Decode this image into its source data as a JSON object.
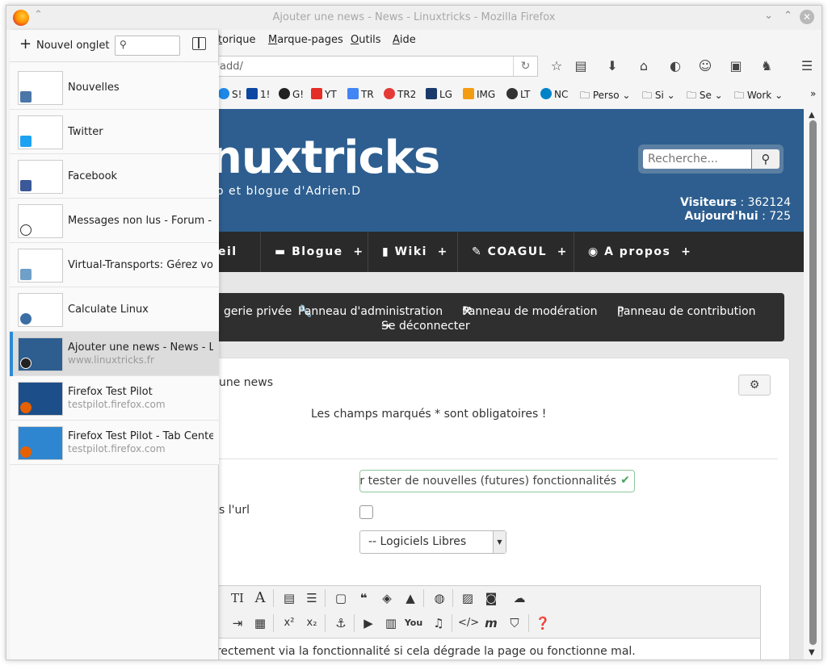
{
  "window": {
    "title": "Ajouter une news - News - Linuxtricks - Mozilla Firefox"
  },
  "menubar": [
    "Historique",
    "Marque-pages",
    "Outils",
    "Aide"
  ],
  "menubar_visible": [
    "torique",
    "Marque-pages",
    "Outils",
    "Aide"
  ],
  "navbar": {
    "url": "add/"
  },
  "bookmarks": [
    {
      "label": "S!",
      "color": "#1e88e5"
    },
    {
      "label": "1!",
      "color": "#0d47a1"
    },
    {
      "label": "G!",
      "color": "#222222"
    },
    {
      "label": "YT",
      "color": "#e52d27"
    },
    {
      "label": "TR",
      "color": "#4285f4"
    },
    {
      "label": "TR2",
      "color": "#e53935"
    },
    {
      "label": "LG",
      "color": "#1a3a6b"
    },
    {
      "label": "IMG",
      "color": "#f39c12"
    },
    {
      "label": "LT",
      "color": "#333333"
    },
    {
      "label": "NC",
      "color": "#0082c9"
    },
    {
      "label": "Perso",
      "color": "#666666"
    },
    {
      "label": "Si",
      "color": "#666666"
    },
    {
      "label": "Se",
      "color": "#666666"
    },
    {
      "label": "Work",
      "color": "#666666"
    }
  ],
  "sidebar": {
    "new_tab": "Nouvel onglet",
    "search_placeholder": "",
    "tabs": [
      {
        "title": "Nouvelles",
        "url": "",
        "fav_color": "#4a76a8"
      },
      {
        "title": "Twitter",
        "url": "",
        "fav_color": "#1da1f2"
      },
      {
        "title": "Facebook",
        "url": "",
        "fav_color": "#3b5998"
      },
      {
        "title": "Messages non lus - Forum - ...",
        "url": "",
        "fav_color": "#ffffff"
      },
      {
        "title": "Virtual-Transports: Gérez vos...",
        "url": "",
        "fav_color": "#6fa0c8"
      },
      {
        "title": "Calculate Linux",
        "url": "",
        "fav_color": "#3a6ea5"
      },
      {
        "title": "Ajouter une news - News - Li...",
        "url": "www.linuxtricks.fr",
        "fav_color": "#222222",
        "active": true
      },
      {
        "title": "Firefox Test Pilot",
        "url": "testpilot.firefox.com",
        "fav_color": "#e66000"
      },
      {
        "title": "Firefox Test Pilot - Tab Center",
        "url": "testpilot.firefox.com",
        "fav_color": "#e66000"
      }
    ]
  },
  "site": {
    "logo": "nuxtricks",
    "tagline": "o et blogue d'Adrien.D",
    "search_placeholder": "Recherche...",
    "visitors_label": "Visiteurs",
    "visitors_value": ": 362124",
    "today_label": "Aujourd'hui",
    "today_value": ": 725",
    "nav": [
      "eil",
      "Blogue",
      "Wiki",
      "COAGUL",
      "A propos"
    ],
    "admin": [
      "gerie privée",
      "Panneau d'administration",
      "Panneau de modération",
      "Panneau de contribution",
      "Se déconnecter"
    ]
  },
  "form": {
    "title": "une news",
    "required_note": "Les champs marqués * sont obligatoires !",
    "title_value": "our tester de nouvelles (futures) fonctionnalités",
    "url_label": "s l'url",
    "category_value": "-- Logiciels Libres",
    "editor_text": "irectement via la fonctionnalité si cela dégrade la page ou fonctionne mal."
  }
}
